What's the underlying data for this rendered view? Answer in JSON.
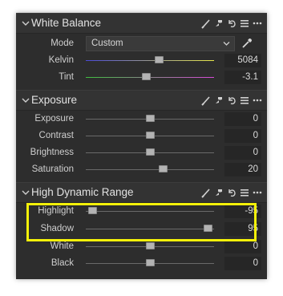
{
  "sections": {
    "white_balance": {
      "title": "White Balance"
    },
    "exposure": {
      "title": "Exposure"
    },
    "hdr": {
      "title": "High Dynamic Range"
    }
  },
  "white_balance": {
    "mode_label": "Mode",
    "mode_value": "Custom",
    "kelvin": {
      "label": "Kelvin",
      "value": "5084",
      "position": 0.57
    },
    "tint": {
      "label": "Tint",
      "value": "-3.1",
      "position": 0.47
    }
  },
  "exposure": {
    "exposure": {
      "label": "Exposure",
      "value": "0",
      "position": 0.5
    },
    "contrast": {
      "label": "Contrast",
      "value": "0",
      "position": 0.5
    },
    "brightness": {
      "label": "Brightness",
      "value": "0",
      "position": 0.5
    },
    "saturation": {
      "label": "Saturation",
      "value": "20",
      "position": 0.6
    }
  },
  "hdr": {
    "highlight": {
      "label": "Highlight",
      "value": "-95",
      "position": 0.05
    },
    "shadow": {
      "label": "Shadow",
      "value": "95",
      "position": 0.95
    },
    "white": {
      "label": "White",
      "value": "0",
      "position": 0.5
    },
    "black": {
      "label": "Black",
      "value": "0",
      "position": 0.5
    }
  },
  "colors": {
    "panel_bg": "#2d2d2d",
    "header_bg": "#333333",
    "highlight_frame": "#f3f009",
    "kelvin_gradient": [
      "#4a4ad8",
      "#e8e84a"
    ],
    "tint_gradient": [
      "#3fbf3f",
      "#d84ad8"
    ]
  },
  "icons": [
    "chevron-down-icon",
    "brush-icon",
    "copy-icon",
    "reset-icon",
    "menu-icon",
    "more-icon",
    "eyedropper-icon"
  ]
}
